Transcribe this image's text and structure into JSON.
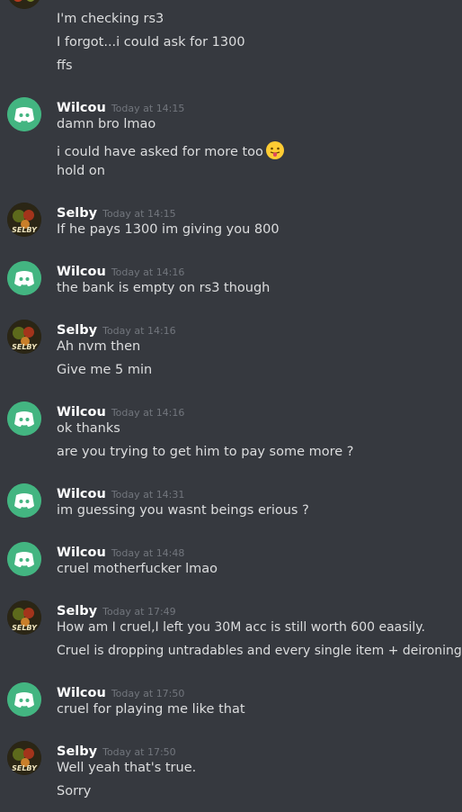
{
  "messages_top": {
    "lines": [
      "I'm checking rs3",
      "I forgot...i could ask for 1300",
      "ffs"
    ]
  },
  "groups": [
    {
      "author": "Wilcou",
      "time": "Today at 14:15",
      "lines": [
        "damn bro lmao",
        "i could have asked for more too",
        "hold on"
      ]
    },
    {
      "author": "Selby",
      "time": "Today at 14:15",
      "lines": [
        "If he pays 1300 im giving you 800"
      ]
    },
    {
      "author": "Wilcou",
      "time": "Today at 14:16",
      "lines": [
        "the bank is empty on rs3 though"
      ]
    },
    {
      "author": "Selby",
      "time": "Today at 14:16",
      "lines": [
        "Ah nvm then",
        "Give me 5 min"
      ]
    },
    {
      "author": "Wilcou",
      "time": "Today at 14:16",
      "lines": [
        "ok thanks",
        "are you trying to get him to pay some more ?"
      ]
    },
    {
      "author": "Wilcou",
      "time": "Today at 14:31",
      "lines": [
        "im guessing you wasnt beings erious ?"
      ]
    },
    {
      "author": "Wilcou",
      "time": "Today at 14:48",
      "lines": [
        "cruel motherfucker lmao"
      ]
    },
    {
      "author": "Selby",
      "time": "Today at 17:49",
      "lines": [
        "How am I cruel,I left you 30M acc is still worth 600 eaasily.",
        "Cruel is dropping untradables and every single item + deironing"
      ]
    },
    {
      "author": "Wilcou",
      "time": "Today at 17:50",
      "lines": [
        "cruel for playing me like that"
      ]
    },
    {
      "author": "Selby",
      "time": "Today at 17:50",
      "lines": [
        "Well yeah that's true.",
        "Sorry"
      ]
    }
  ],
  "icons": {
    "wilcou_avatar": "discord-logo-icon",
    "selby_avatar": "selby-avatar-image",
    "emoji": "tongue-out-emoji-icon"
  },
  "colors": {
    "background": "#36393f",
    "text": "#dcddde",
    "username": "#ffffff",
    "timestamp": "#72767d",
    "discord_green": "#43b581"
  }
}
